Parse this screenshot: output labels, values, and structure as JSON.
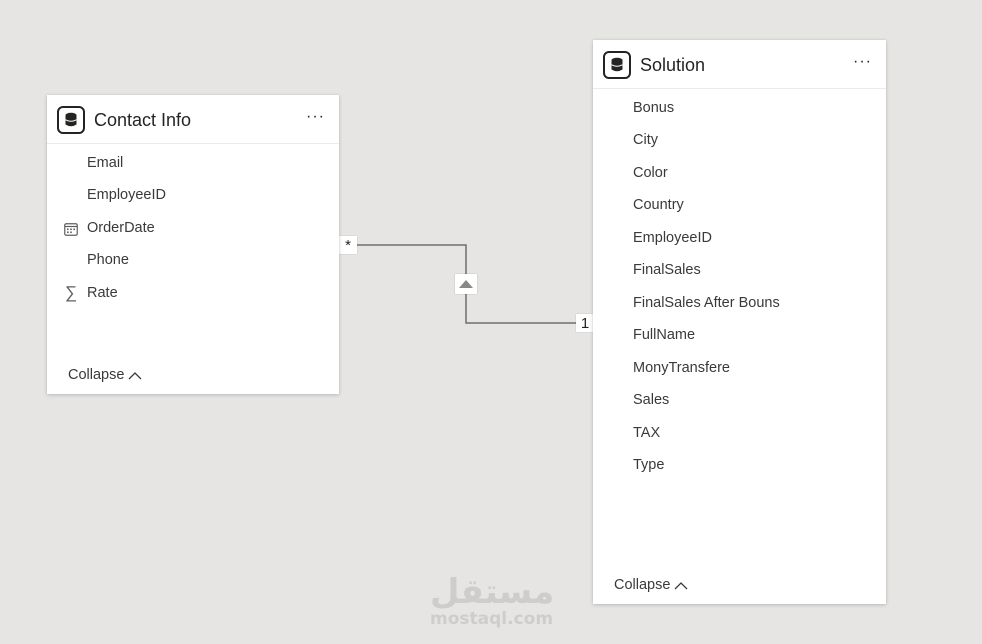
{
  "tables": {
    "contact_info": {
      "title": "Contact Info",
      "more_label": "···",
      "icon": "table-icon",
      "fields": [
        {
          "label": "Email",
          "icon": ""
        },
        {
          "label": "EmployeeID",
          "icon": ""
        },
        {
          "label": "OrderDate",
          "icon": "calendar-icon"
        },
        {
          "label": "Phone",
          "icon": ""
        },
        {
          "label": "Rate",
          "icon": "sigma-icon"
        }
      ],
      "collapse_label": "Collapse"
    },
    "solution": {
      "title": "Solution",
      "more_label": "···",
      "icon": "table-icon",
      "fields": [
        {
          "label": "Bonus"
        },
        {
          "label": "City"
        },
        {
          "label": "Color"
        },
        {
          "label": "Country"
        },
        {
          "label": "EmployeeID"
        },
        {
          "label": "FinalSales"
        },
        {
          "label": "FinalSales After Bouns"
        },
        {
          "label": "FullName"
        },
        {
          "label": "MonyTransfere"
        },
        {
          "label": "Sales"
        },
        {
          "label": "TAX"
        },
        {
          "label": "Type"
        }
      ],
      "collapse_label": "Collapse"
    }
  },
  "relationship": {
    "many_side_label": "*",
    "one_side_label": "1",
    "filter_direction_icon": "triangle-up-icon"
  },
  "watermark": {
    "arabic": "مستقل",
    "latin": "mostaql.com"
  }
}
